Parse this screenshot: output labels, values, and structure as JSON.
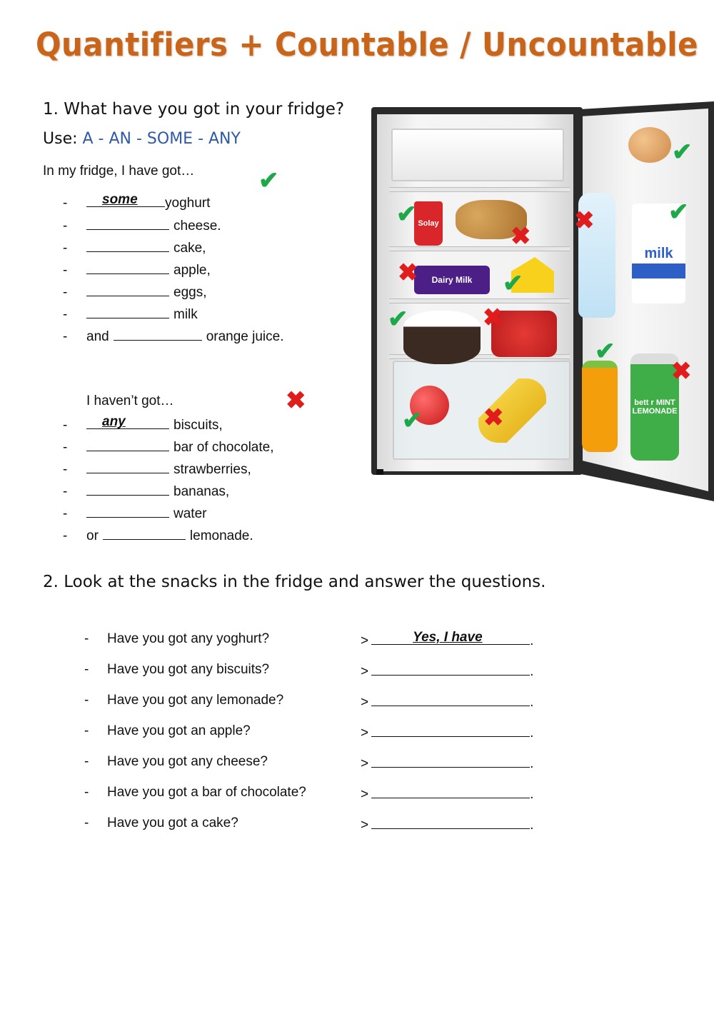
{
  "title": "Quantifiers + Countable / Uncountable",
  "section1": {
    "heading": "1. What have you got in your fridge?",
    "use_label": "Use:",
    "use_options": "A - AN - SOME  - ANY",
    "have_intro": "In my fridge, I have got…",
    "have_items": [
      {
        "prefix": "",
        "answer": "some",
        "item": "yoghurt"
      },
      {
        "prefix": "",
        "answer": "",
        "item": "cheese."
      },
      {
        "prefix": "",
        "answer": "",
        "item": "cake,"
      },
      {
        "prefix": "",
        "answer": "",
        "item": "apple,"
      },
      {
        "prefix": "",
        "answer": "",
        "item": "eggs,"
      },
      {
        "prefix": "",
        "answer": "",
        "item": "milk"
      },
      {
        "prefix": "and",
        "answer": "",
        "item": "orange juice."
      }
    ],
    "havent_intro": "I haven’t got…",
    "havent_items": [
      {
        "prefix": "",
        "answer": "any",
        "item": "biscuits,"
      },
      {
        "prefix": "",
        "answer": "",
        "item": "bar of chocolate,"
      },
      {
        "prefix": "",
        "answer": "",
        "item": "strawberries,"
      },
      {
        "prefix": "",
        "answer": "",
        "item": "bananas,"
      },
      {
        "prefix": "",
        "answer": "",
        "item": "water"
      },
      {
        "prefix": "or",
        "answer": "",
        "item": "lemonade."
      }
    ],
    "dash": "-",
    "check_icon": "✔",
    "cross_icon": "✖"
  },
  "fridge": {
    "items": [
      {
        "name": "yoghurt",
        "label": "Solay",
        "status": "have"
      },
      {
        "name": "biscuits",
        "label": "",
        "status": "not"
      },
      {
        "name": "chocolate",
        "label": "Dairy Milk",
        "status": "not"
      },
      {
        "name": "cheese",
        "label": "",
        "status": "have"
      },
      {
        "name": "cake",
        "label": "",
        "status": "have"
      },
      {
        "name": "strawberries",
        "label": "",
        "status": "not"
      },
      {
        "name": "apple",
        "label": "",
        "status": "have"
      },
      {
        "name": "bananas",
        "label": "",
        "status": "not"
      },
      {
        "name": "eggs",
        "label": "",
        "status": "have"
      },
      {
        "name": "water",
        "label": "",
        "status": "not"
      },
      {
        "name": "milk",
        "label": "milk",
        "status": "have"
      },
      {
        "name": "orange-juice",
        "label": "",
        "status": "have"
      },
      {
        "name": "lemonade",
        "label": "bett r MINT LEMONADE",
        "status": "not"
      }
    ]
  },
  "section2": {
    "heading": "2. Look at the snacks in the fridge and answer the questions.",
    "arrow": ">",
    "end": ".",
    "questions": [
      {
        "q": "Have you got any yoghurt?",
        "answer": "Yes, I have"
      },
      {
        "q": "Have you got any biscuits?",
        "answer": ""
      },
      {
        "q": "Have you got any lemonade?",
        "answer": ""
      },
      {
        "q": "Have you got an apple?",
        "answer": ""
      },
      {
        "q": "Have you got any cheese?",
        "answer": ""
      },
      {
        "q": "Have you got a bar of chocolate?",
        "answer": ""
      },
      {
        "q": "Have you got a cake?",
        "answer": ""
      }
    ]
  }
}
